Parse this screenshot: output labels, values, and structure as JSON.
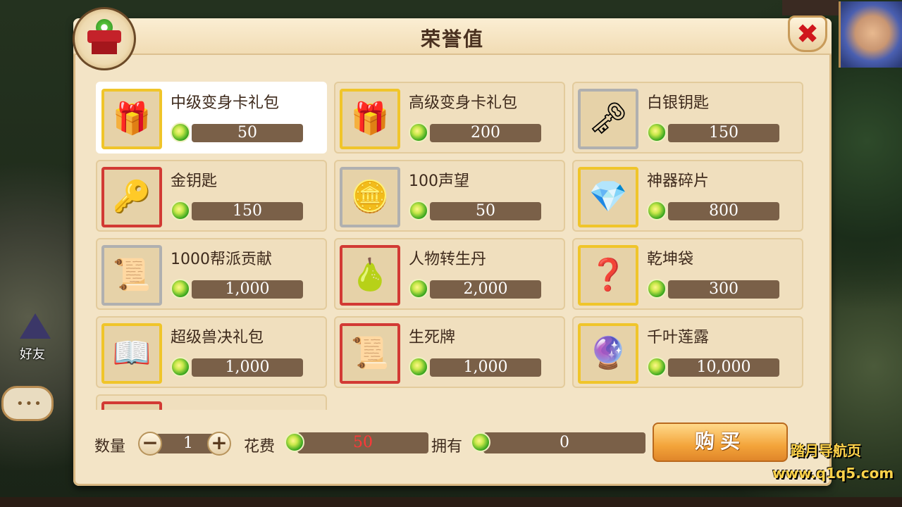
{
  "window": {
    "title": "荣誉值"
  },
  "items": [
    {
      "name": "中级变身卡礼包",
      "price": "50",
      "icon": "gift-bag-icon",
      "frame": "gold",
      "selected": true
    },
    {
      "name": "高级变身卡礼包",
      "price": "200",
      "icon": "gift-bag-icon",
      "frame": "gold",
      "selected": false
    },
    {
      "name": "白银钥匙",
      "price": "150",
      "icon": "silver-key-icon",
      "frame": "silver",
      "selected": false
    },
    {
      "name": "金钥匙",
      "price": "150",
      "icon": "gold-key-icon",
      "frame": "red",
      "selected": false
    },
    {
      "name": "100声望",
      "price": "50",
      "icon": "prestige-coin-icon",
      "frame": "silver",
      "selected": false
    },
    {
      "name": "神器碎片",
      "price": "800",
      "icon": "crystal-shard-icon",
      "frame": "gold",
      "selected": false
    },
    {
      "name": "1000帮派贡献",
      "price": "1,000",
      "icon": "guild-token-icon",
      "frame": "silver",
      "selected": false
    },
    {
      "name": "人物转生丹",
      "price": "2,000",
      "icon": "gourd-icon",
      "frame": "red",
      "selected": false
    },
    {
      "name": "乾坤袋",
      "price": "300",
      "icon": "mystery-orb-icon",
      "frame": "gold",
      "selected": false
    },
    {
      "name": "超级兽决礼包",
      "price": "1,000",
      "icon": "scroll-book-icon",
      "frame": "gold",
      "selected": false
    },
    {
      "name": "生死牌",
      "price": "1,000",
      "icon": "purple-scroll-icon",
      "frame": "red",
      "selected": false
    },
    {
      "name": "千叶莲露",
      "price": "10,000",
      "icon": "lotus-orb-icon",
      "frame": "gold",
      "selected": false
    },
    {
      "name": "",
      "price": "",
      "icon": "partial-item-icon",
      "frame": "red",
      "selected": false
    }
  ],
  "footer": {
    "qty_label": "数量",
    "qty_value": "1",
    "minus": "−",
    "plus": "+",
    "cost_label": "花费",
    "cost_value": "50",
    "own_label": "拥有",
    "own_value": "0",
    "buy_label": "购买"
  },
  "side": {
    "friends_label": "好友",
    "chat_dots": "•••"
  },
  "watermark": {
    "line1": "踏月导航页",
    "line2": "www.q1q5.com"
  },
  "close_glyph": "✖",
  "colors": {
    "price_bar": "#7a6048",
    "cost_text": "#ff3838",
    "buy_button": "#f3a43a",
    "panel_bg": "#f3e4c6"
  }
}
